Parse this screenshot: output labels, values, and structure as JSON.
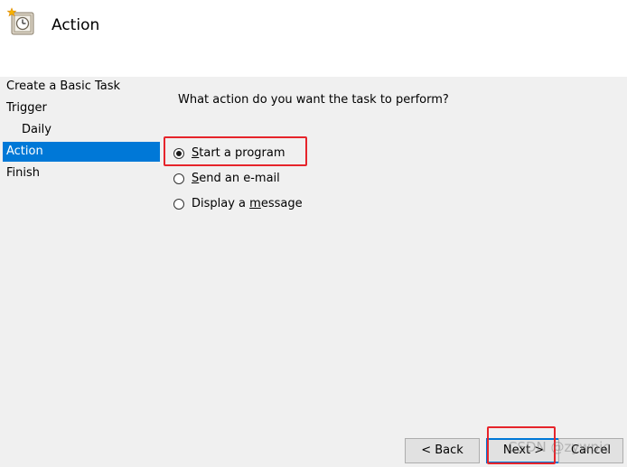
{
  "header": {
    "title": "Action",
    "icon": "task-clock-icon"
  },
  "sidebar": {
    "items": [
      {
        "label": "Create a Basic Task",
        "selected": false
      },
      {
        "label": "Trigger",
        "selected": false
      },
      {
        "label": "Daily",
        "selected": false
      },
      {
        "label": "Action",
        "selected": true
      },
      {
        "label": "Finish",
        "selected": false
      }
    ]
  },
  "main": {
    "question": "What action do you want the task to perform?",
    "options": [
      {
        "pre": "",
        "access": "S",
        "post": "tart a program",
        "checked": true
      },
      {
        "pre": "",
        "access": "S",
        "post": "end an e-mail",
        "checked": false
      },
      {
        "pre": "Display a ",
        "access": "m",
        "post": "essage",
        "checked": false
      }
    ]
  },
  "buttons": {
    "back": "< Back",
    "next": "Next >",
    "cancel": "Cancel"
  },
  "watermark": "CSDN @zywpic",
  "colors": {
    "selection": "#0078d7",
    "highlight": "#e6242b"
  }
}
